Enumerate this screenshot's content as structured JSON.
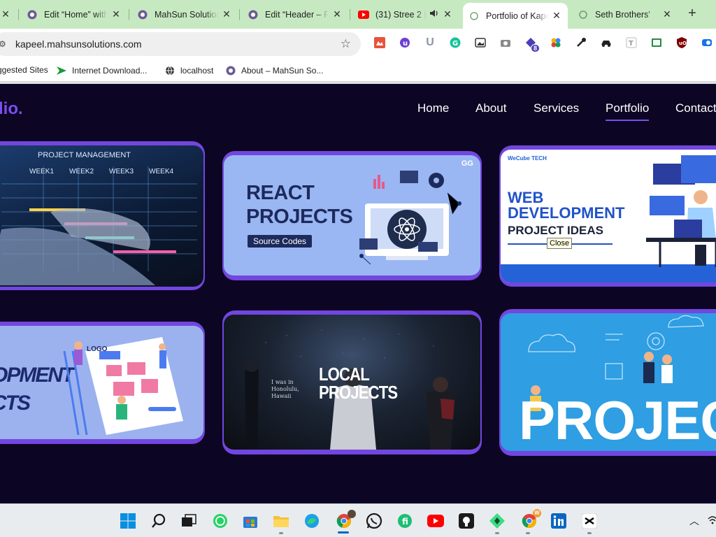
{
  "browser": {
    "tabs": [
      {
        "title": "Edit “Home” with",
        "icon": "wordpress-icon",
        "close": "✕"
      },
      {
        "title": "MahSun Solution",
        "icon": "wordpress-icon",
        "close": "✕"
      },
      {
        "title": "Edit “Header – P",
        "icon": "wordpress-icon",
        "close": "✕"
      },
      {
        "title": "(31) Stree 2 |",
        "icon": "youtube-icon",
        "close": "✕"
      },
      {
        "title": "Portfolio of Kape",
        "icon": "globe-icon",
        "close": "✕",
        "active": true
      },
      {
        "title": "Seth Brothers'",
        "icon": "globe-icon",
        "close": "✕"
      }
    ],
    "new_tab": "+",
    "url": "kapeel.mahsunsolutions.com",
    "extension_badge": "8",
    "bookmarks": [
      {
        "label": "ggested Sites",
        "icon": "ie-icon"
      },
      {
        "label": "Internet Download...",
        "icon": "idm-icon"
      },
      {
        "label": "localhost",
        "icon": "globe-icon"
      },
      {
        "label": "About – MahSun So...",
        "icon": "wordpress-icon"
      }
    ]
  },
  "site": {
    "logo": "lio.",
    "nav": [
      "Home",
      "About",
      "Services",
      "Portfolio",
      "Contact"
    ],
    "active_nav": "Portfolio",
    "accent_color": "#7346e0",
    "background_color": "#0c0523"
  },
  "portfolio": {
    "cards": [
      {
        "label": "PROJECT MANAGEMENT",
        "extra": [
          "WEEK1",
          "WEEK2",
          "WEEK3",
          "WEEK4"
        ]
      },
      {
        "line1": "REACT",
        "line2": "PROJECTS",
        "tag": "Source Codes",
        "brand": "GG"
      },
      {
        "brand": "WeCube TECH",
        "line1": "WEB",
        "line2": "DEVELOPMENT",
        "line3": "PROJECT IDEAS"
      },
      {
        "line1": "OPMENT",
        "line2": "CTS",
        "tag": "LOGO"
      },
      {
        "line1": "LOCAL",
        "line2": "PROJECTS",
        "caption1": "I was in",
        "caption2": "Honolulu,",
        "caption3": "Hawaii"
      },
      {
        "line1": "PROJECT"
      }
    ]
  },
  "tooltip": "Close",
  "taskbar": {
    "icons": [
      "windows-start-icon",
      "search-icon",
      "task-view-icon",
      "whatsapp-icon",
      "store-icon",
      "file-explorer-icon",
      "edge-icon",
      "chrome-icon",
      "whatsapp-icon",
      "fiverr-icon",
      "youtube-icon",
      "github-icon",
      "android-studio-icon",
      "chrome-icon",
      "linkedin-icon",
      "capcut-icon"
    ],
    "chrome_badge": "W"
  }
}
